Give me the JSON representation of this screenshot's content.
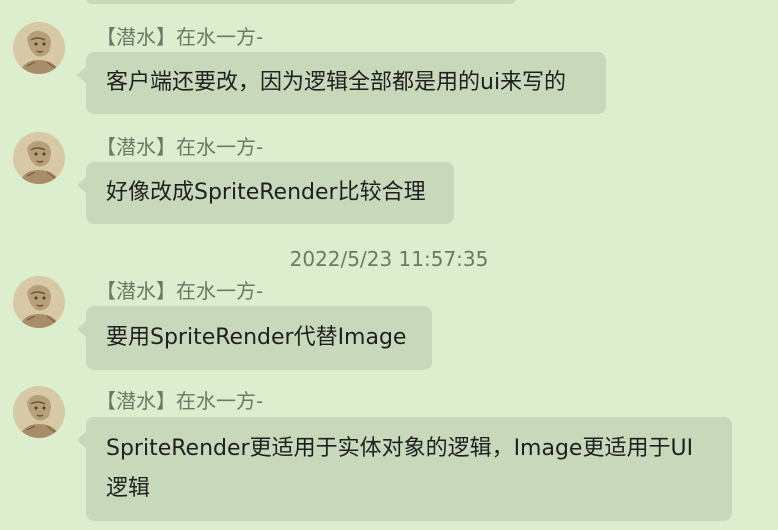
{
  "messages": [
    {
      "sender": "【潜水】在水一方-",
      "text": "客户端还要改，因为逻辑全部都是用的ui来写的"
    },
    {
      "sender": "【潜水】在水一方-",
      "text": "好像改成SpriteRender比较合理"
    },
    {
      "sender": "【潜水】在水一方-",
      "text": "要用SpriteRender代替Image"
    },
    {
      "sender": "【潜水】在水一方-",
      "text": "SpriteRender更适用于实体对象的逻辑，Image更适用于UI逻辑"
    }
  ],
  "timestamp": "2022/5/23 11:57:35",
  "avatar_icon": "sketch-portrait-icon",
  "colors": {
    "background": "#ddeecf",
    "bubble": "#c8d8bb",
    "meta_text": "#6e7868"
  }
}
